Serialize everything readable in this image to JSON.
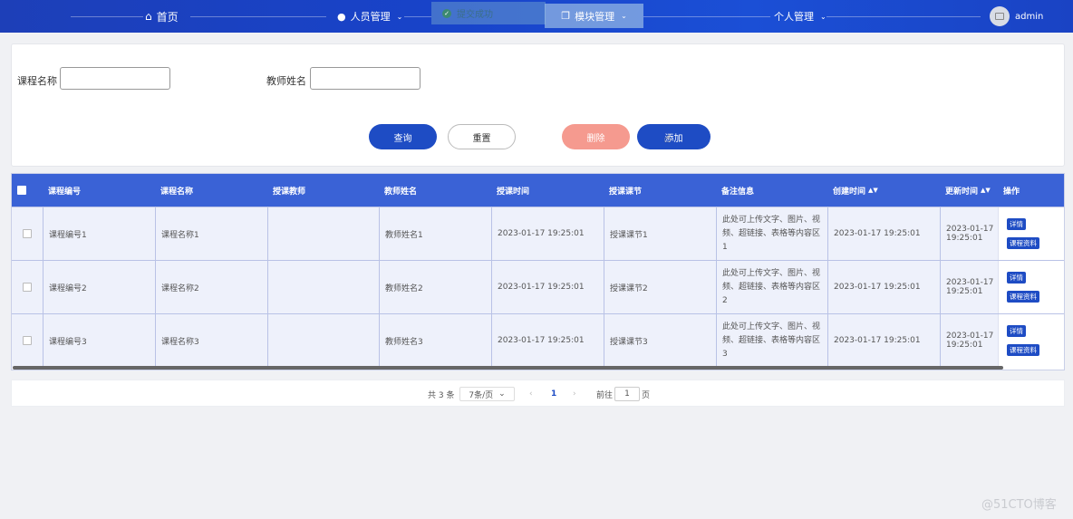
{
  "nav": {
    "home": "首页",
    "staff": "人员管理",
    "module": "模块管理",
    "personal": "个人管理",
    "toast": "提交成功",
    "user": "admin"
  },
  "search": {
    "course_name_label": "课程名称",
    "course_name_value": "",
    "teacher_name_label": "教师姓名",
    "teacher_name_value": "",
    "query": "查询",
    "reset": "重置",
    "delete": "删除",
    "add": "添加"
  },
  "table": {
    "columns": [
      "课程编号",
      "课程名称",
      "授课教师",
      "教师姓名",
      "授课时间",
      "授课课节",
      "备注信息",
      "创建时间",
      "更新时间",
      "操作"
    ],
    "rows": [
      {
        "code": "课程编号1",
        "name": "课程名称1",
        "teacher": "",
        "teacher_name": "教师姓名1",
        "time": "2023-01-17 19:25:01",
        "section": "授课课节1",
        "remark": "此处可上传文字、图片、视频、超链接、表格等内容区1",
        "created": "2023-01-17 19:25:01",
        "updated": "2023-01-17 19:25:01"
      },
      {
        "code": "课程编号2",
        "name": "课程名称2",
        "teacher": "",
        "teacher_name": "教师姓名2",
        "time": "2023-01-17 19:25:01",
        "section": "授课课节2",
        "remark": "此处可上传文字、图片、视频、超链接、表格等内容区2",
        "created": "2023-01-17 19:25:01",
        "updated": "2023-01-17 19:25:01"
      },
      {
        "code": "课程编号3",
        "name": "课程名称3",
        "teacher": "",
        "teacher_name": "教师姓名3",
        "time": "2023-01-17 19:25:01",
        "section": "授课课节3",
        "remark": "此处可上传文字、图片、视频、超链接、表格等内容区3",
        "created": "2023-01-17 19:25:01",
        "updated": "2023-01-17 19:25:01"
      }
    ],
    "actions": {
      "detail": "详情",
      "materials": "课程资料"
    }
  },
  "pager": {
    "total": "共 3 条",
    "page_size": "7条/页",
    "prev": "‹",
    "current": "1",
    "next": "›",
    "goto_label": "前往",
    "goto_value": "1",
    "goto_suffix": "页"
  },
  "watermark": "@51CTO博客",
  "colors": {
    "nav": "#1843c9",
    "primary": "#1e4cc4",
    "danger": "#f59a8f",
    "header": "#3a62d6"
  }
}
